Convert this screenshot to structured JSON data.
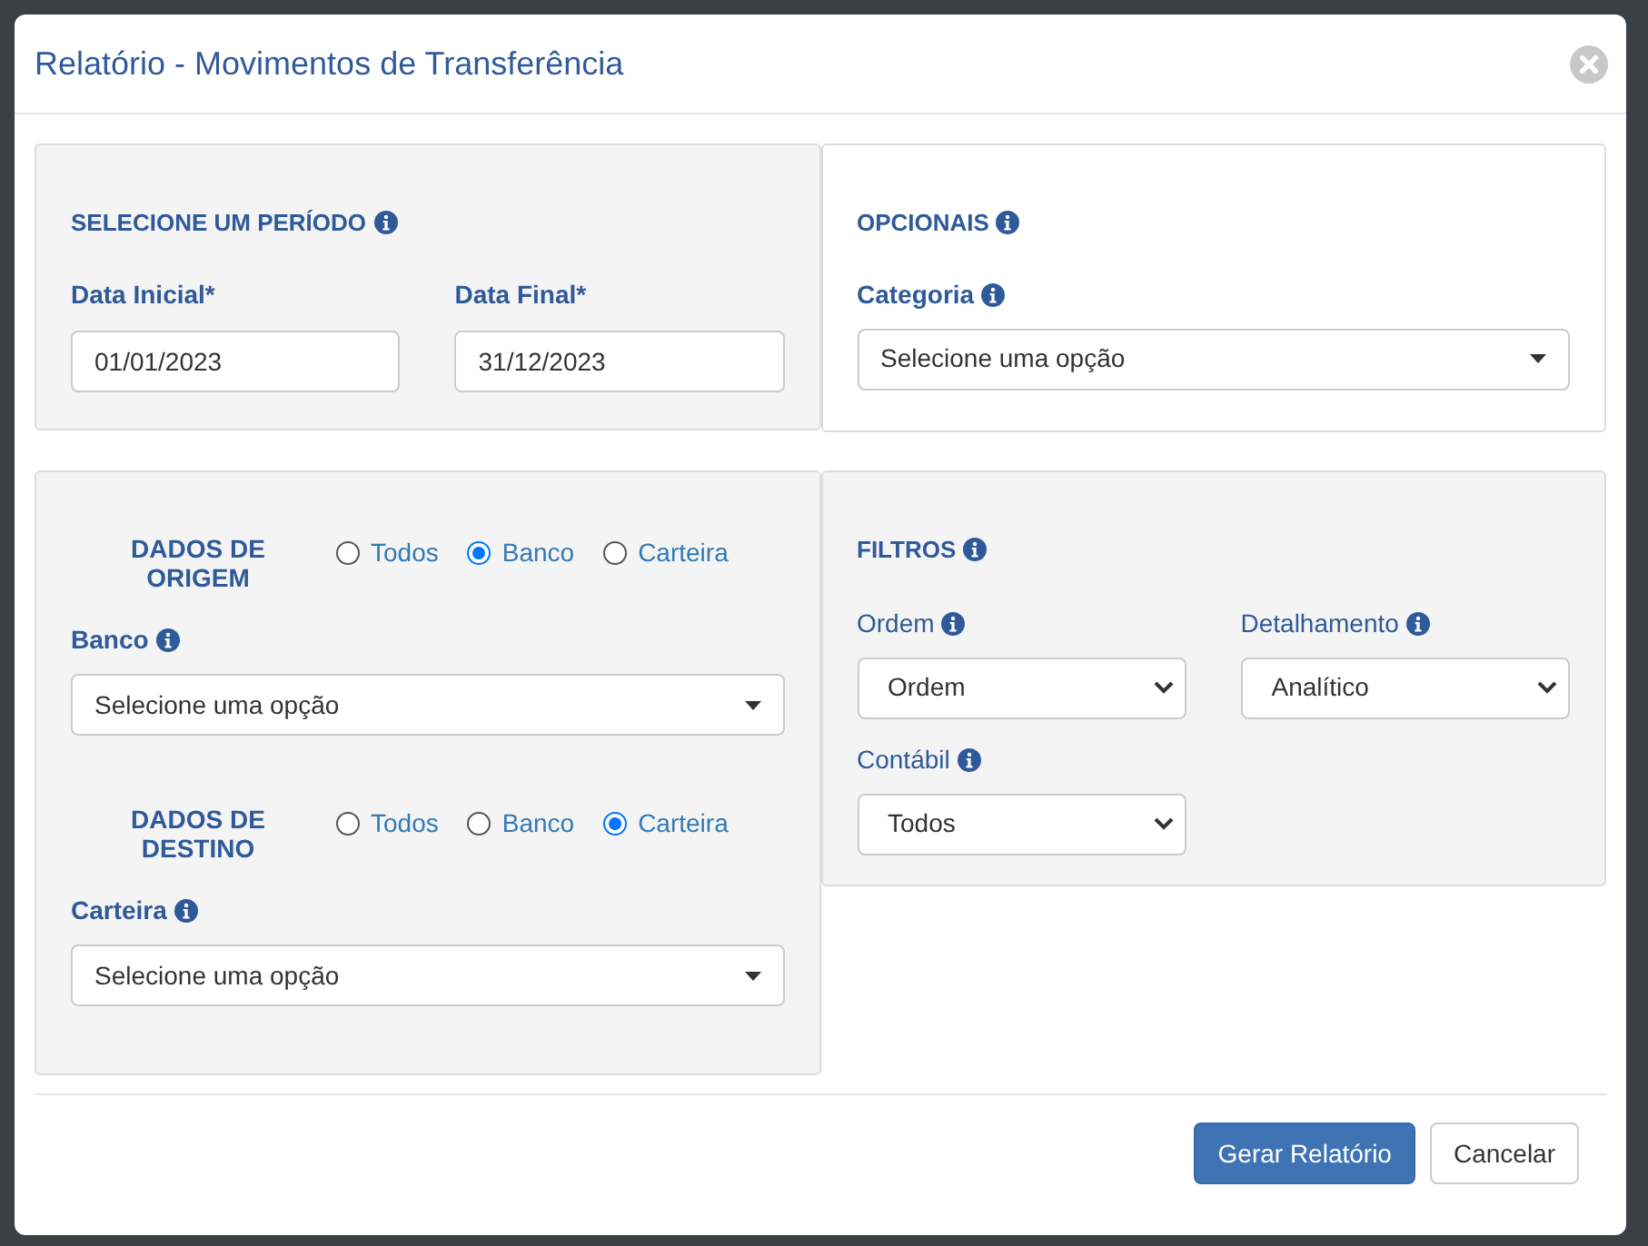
{
  "modal": {
    "title": "Relatório - Movimentos de Transferência"
  },
  "periodo": {
    "heading": "SELECIONE UM PERÍODO",
    "fields": [
      {
        "label": "Data Inicial*",
        "value": "01/01/2023"
      },
      {
        "label": "Data Final*",
        "value": "31/12/2023"
      }
    ]
  },
  "opcionais": {
    "heading": "OPCIONAIS",
    "field": {
      "label": "Categoria",
      "value": "Selecione uma opção"
    }
  },
  "dados": [
    {
      "heading": "DADOS DE ORIGEM",
      "options": [
        {
          "label": "Todos",
          "selected": false
        },
        {
          "label": "Banco",
          "selected": true
        },
        {
          "label": "Carteira",
          "selected": false
        }
      ],
      "field": {
        "label": "Banco",
        "value": "Selecione uma opção"
      }
    },
    {
      "heading": "DADOS DE DESTINO",
      "options": [
        {
          "label": "Todos",
          "selected": false
        },
        {
          "label": "Banco",
          "selected": false
        },
        {
          "label": "Carteira",
          "selected": true
        }
      ],
      "field": {
        "label": "Carteira",
        "value": "Selecione uma opção"
      }
    }
  ],
  "filtros": {
    "heading": "FILTROS",
    "fields": [
      {
        "label": "Ordem",
        "value": "Ordem"
      },
      {
        "label": "Detalhamento",
        "value": "Analítico"
      },
      {
        "label": "Contábil",
        "value": "Todos"
      }
    ]
  },
  "footer_buttons": [
    {
      "label": "Gerar Relatório",
      "kind": "primary"
    },
    {
      "label": "Cancelar",
      "kind": "default"
    }
  ]
}
